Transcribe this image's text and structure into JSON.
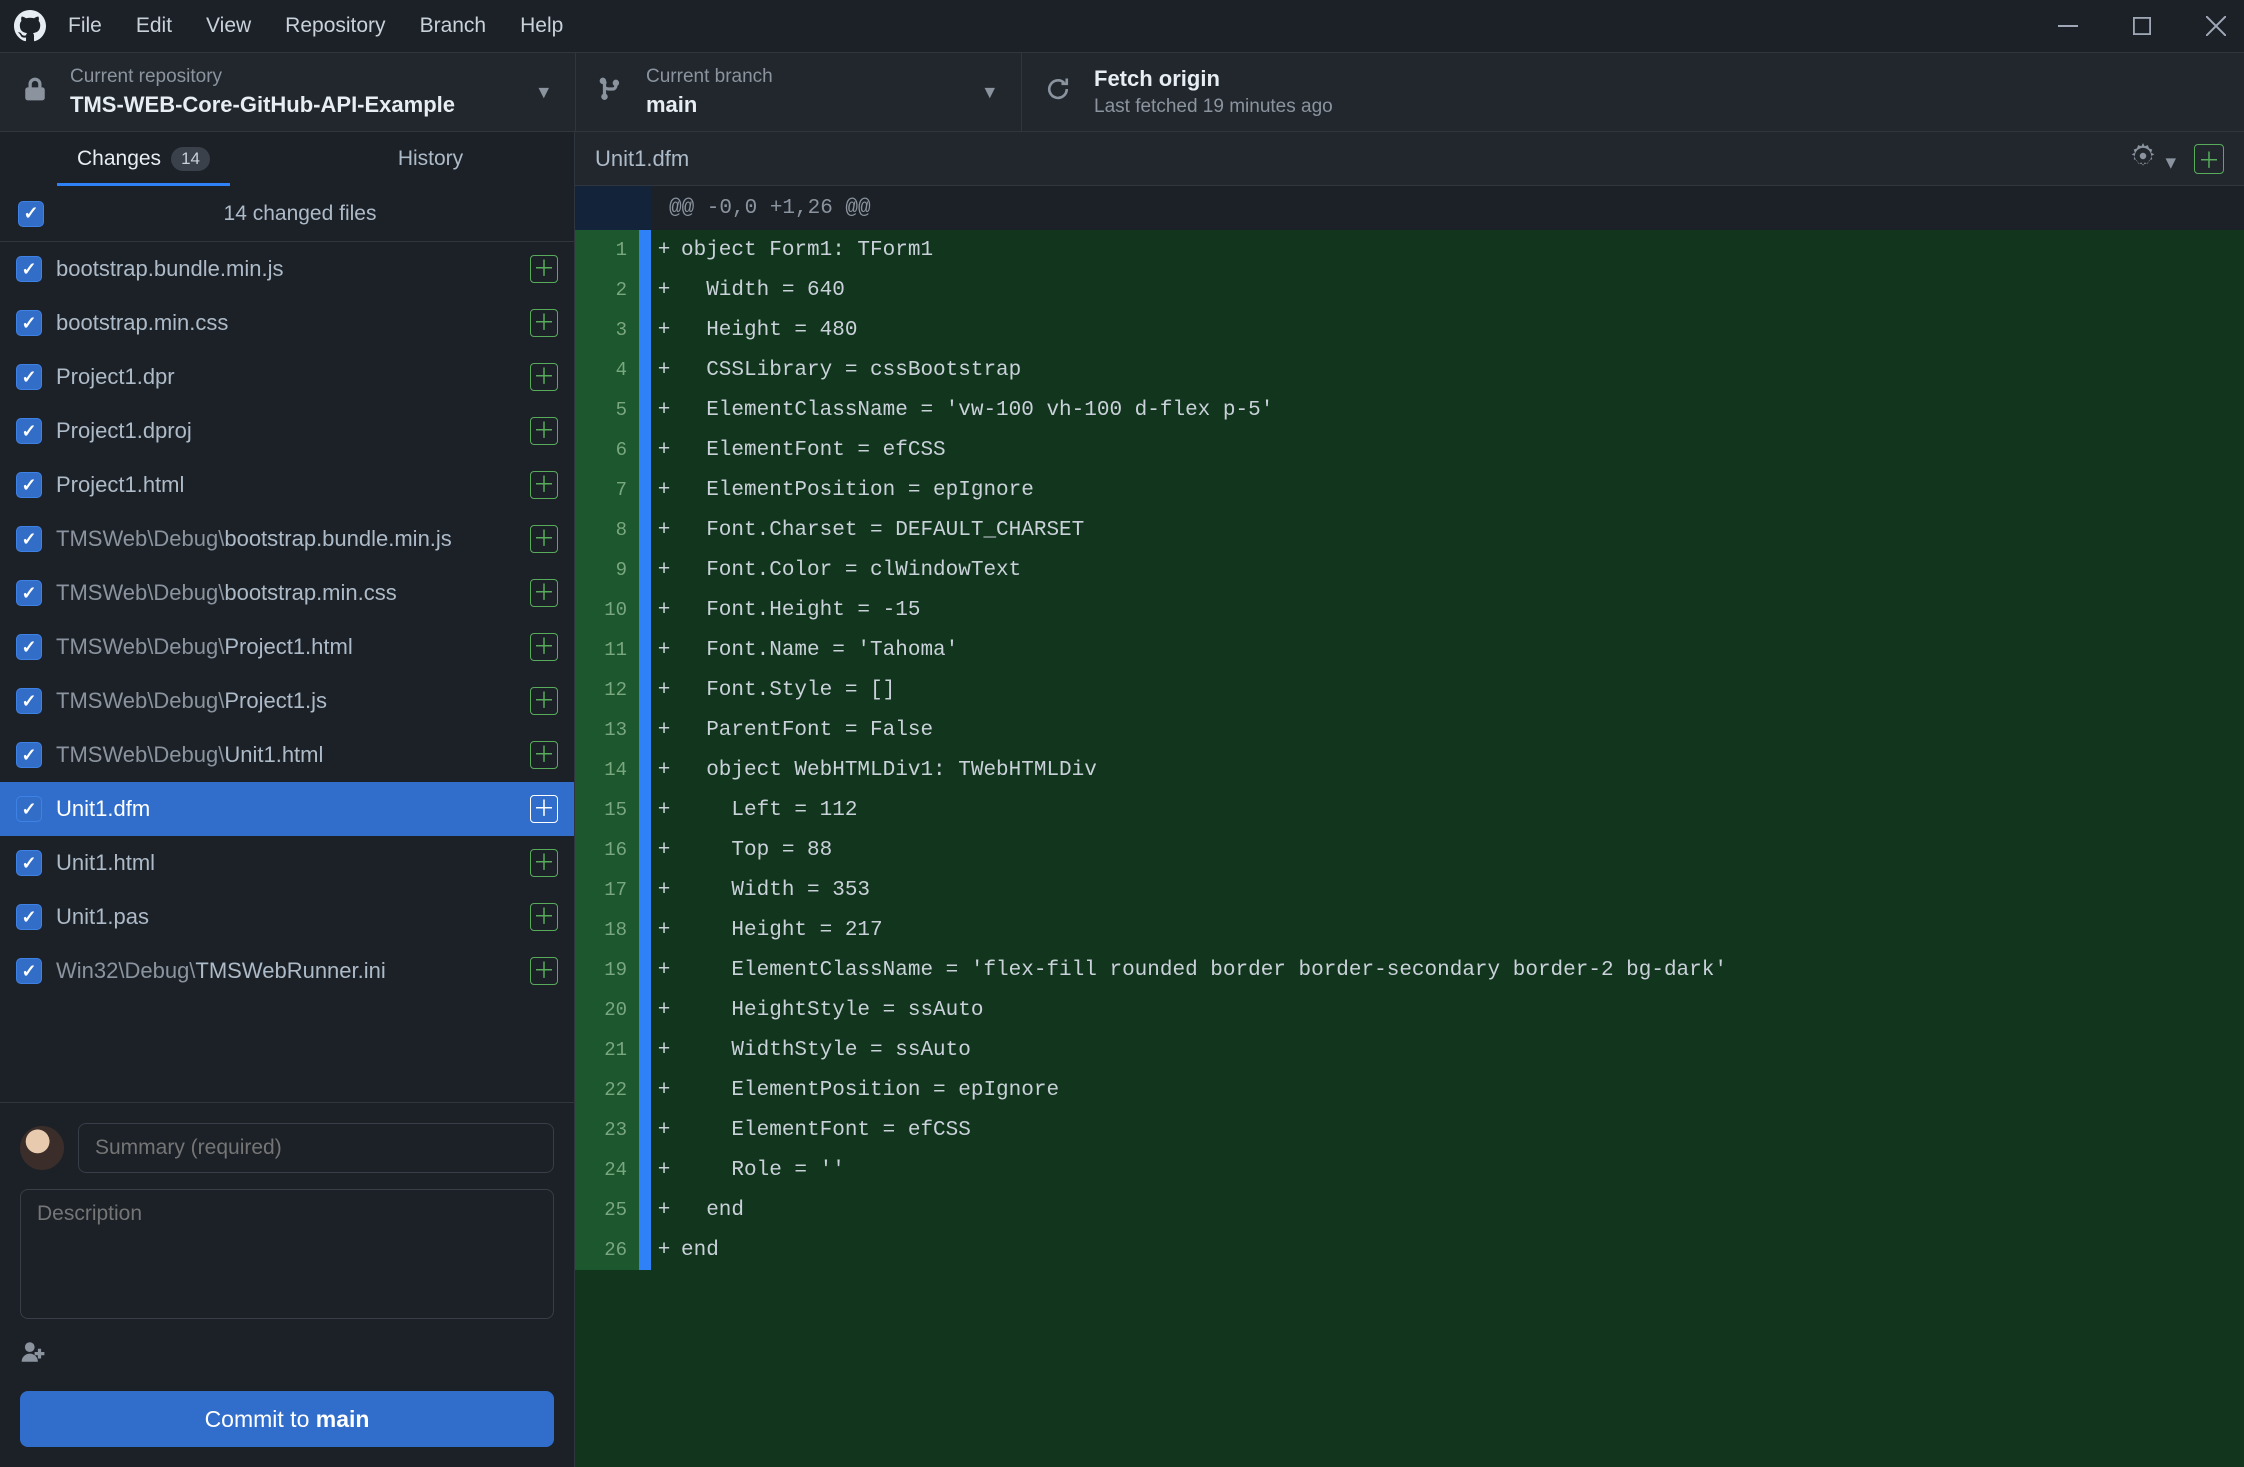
{
  "menu": {
    "items": [
      "File",
      "Edit",
      "View",
      "Repository",
      "Branch",
      "Help"
    ]
  },
  "toolbar": {
    "repo": {
      "sub": "Current repository",
      "main": "TMS-WEB-Core-GitHub-API-Example"
    },
    "branch": {
      "sub": "Current branch",
      "main": "main"
    },
    "fetch": {
      "sub": "Last fetched 19 minutes ago",
      "main": "Fetch origin"
    }
  },
  "tabs": {
    "changes": {
      "label": "Changes",
      "count": "14"
    },
    "history": {
      "label": "History"
    }
  },
  "changed_files_label": "14 changed files",
  "files": [
    {
      "dir": "",
      "name": "bootstrap.bundle.min.js",
      "selected": false
    },
    {
      "dir": "",
      "name": "bootstrap.min.css",
      "selected": false
    },
    {
      "dir": "",
      "name": "Project1.dpr",
      "selected": false
    },
    {
      "dir": "",
      "name": "Project1.dproj",
      "selected": false
    },
    {
      "dir": "",
      "name": "Project1.html",
      "selected": false
    },
    {
      "dir": "TMSWeb\\Debug\\",
      "name": "bootstrap.bundle.min.js",
      "selected": false
    },
    {
      "dir": "TMSWeb\\Debug\\",
      "name": "bootstrap.min.css",
      "selected": false
    },
    {
      "dir": "TMSWeb\\Debug\\",
      "name": "Project1.html",
      "selected": false
    },
    {
      "dir": "TMSWeb\\Debug\\",
      "name": "Project1.js",
      "selected": false
    },
    {
      "dir": "TMSWeb\\Debug\\",
      "name": "Unit1.html",
      "selected": false
    },
    {
      "dir": "",
      "name": "Unit1.dfm",
      "selected": true
    },
    {
      "dir": "",
      "name": "Unit1.html",
      "selected": false
    },
    {
      "dir": "",
      "name": "Unit1.pas",
      "selected": false
    },
    {
      "dir": "Win32\\Debug\\",
      "name": "TMSWebRunner.ini",
      "selected": false
    }
  ],
  "commit": {
    "summary_placeholder": "Summary (required)",
    "description_placeholder": "Description",
    "button_prefix": "Commit to ",
    "button_branch": "main"
  },
  "diff": {
    "file_label": "Unit1.dfm",
    "hunk": "@@ -0,0 +1,26 @@",
    "lines": [
      "object Form1: TForm1",
      "  Width = 640",
      "  Height = 480",
      "  CSSLibrary = cssBootstrap",
      "  ElementClassName = 'vw-100 vh-100 d-flex p-5'",
      "  ElementFont = efCSS",
      "  ElementPosition = epIgnore",
      "  Font.Charset = DEFAULT_CHARSET",
      "  Font.Color = clWindowText",
      "  Font.Height = -15",
      "  Font.Name = 'Tahoma'",
      "  Font.Style = []",
      "  ParentFont = False",
      "  object WebHTMLDiv1: TWebHTMLDiv",
      "    Left = 112",
      "    Top = 88",
      "    Width = 353",
      "    Height = 217",
      "    ElementClassName = 'flex-fill rounded border border-secondary border-2 bg-dark'",
      "    HeightStyle = ssAuto",
      "    WidthStyle = ssAuto",
      "    ElementPosition = epIgnore",
      "    ElementFont = efCSS",
      "    Role = ''",
      "  end",
      "end"
    ]
  }
}
